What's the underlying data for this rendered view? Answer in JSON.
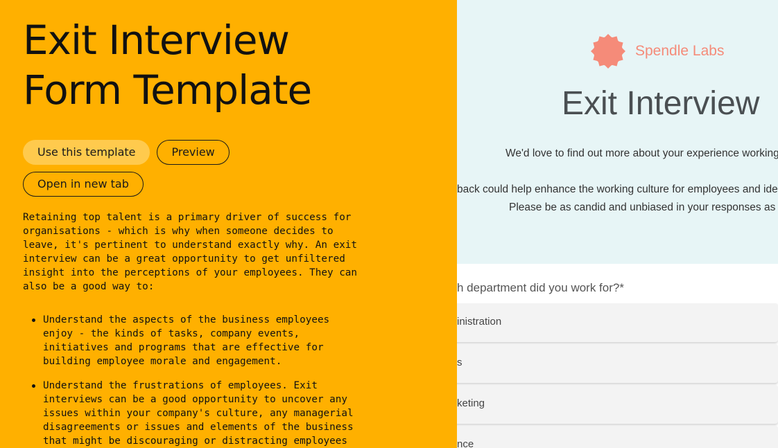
{
  "template": {
    "title_line1": "Exit Interview",
    "title_line2": "Form Template",
    "buttons": {
      "use_template": "Use this template",
      "preview": "Preview",
      "open_new_tab": "Open in new tab"
    },
    "description": "Retaining top talent is a primary driver of success for organisations - which is why when someone decides to leave, it's pertinent to understand exactly why. An exit interview can be a great opportunity to get unfiltered insight into the perceptions of your employees. They can also be a good way to:",
    "bullets": [
      "Understand the aspects of the business employees enjoy - the kinds of tasks, company events, initiatives and programs that are effective for building employee morale and engagement.",
      "Understand the frustrations of employees. Exit interviews can be a good opportunity to uncover any issues within your company's culture, any managerial disagreements or issues and elements of the business that might be discouraging or distracting employees on a regular basis."
    ]
  },
  "form_preview": {
    "brand_name": "Spendle Labs",
    "title": "Exit Interview",
    "intro_line1": "We'd love to find out more about your experience working",
    "intro_line2": "back could help enhance the working culture for employees and ide",
    "intro_line3": "Please be as candid and unbiased in your responses as p",
    "question": "h department did you work for?*",
    "options": [
      "inistration",
      "s",
      "keting",
      "nce"
    ]
  },
  "colors": {
    "left_background": "#FFB000",
    "primary_button": "#FFCA4D",
    "form_header_background": "#E7F5F6",
    "brand_accent": "#F58B79"
  }
}
